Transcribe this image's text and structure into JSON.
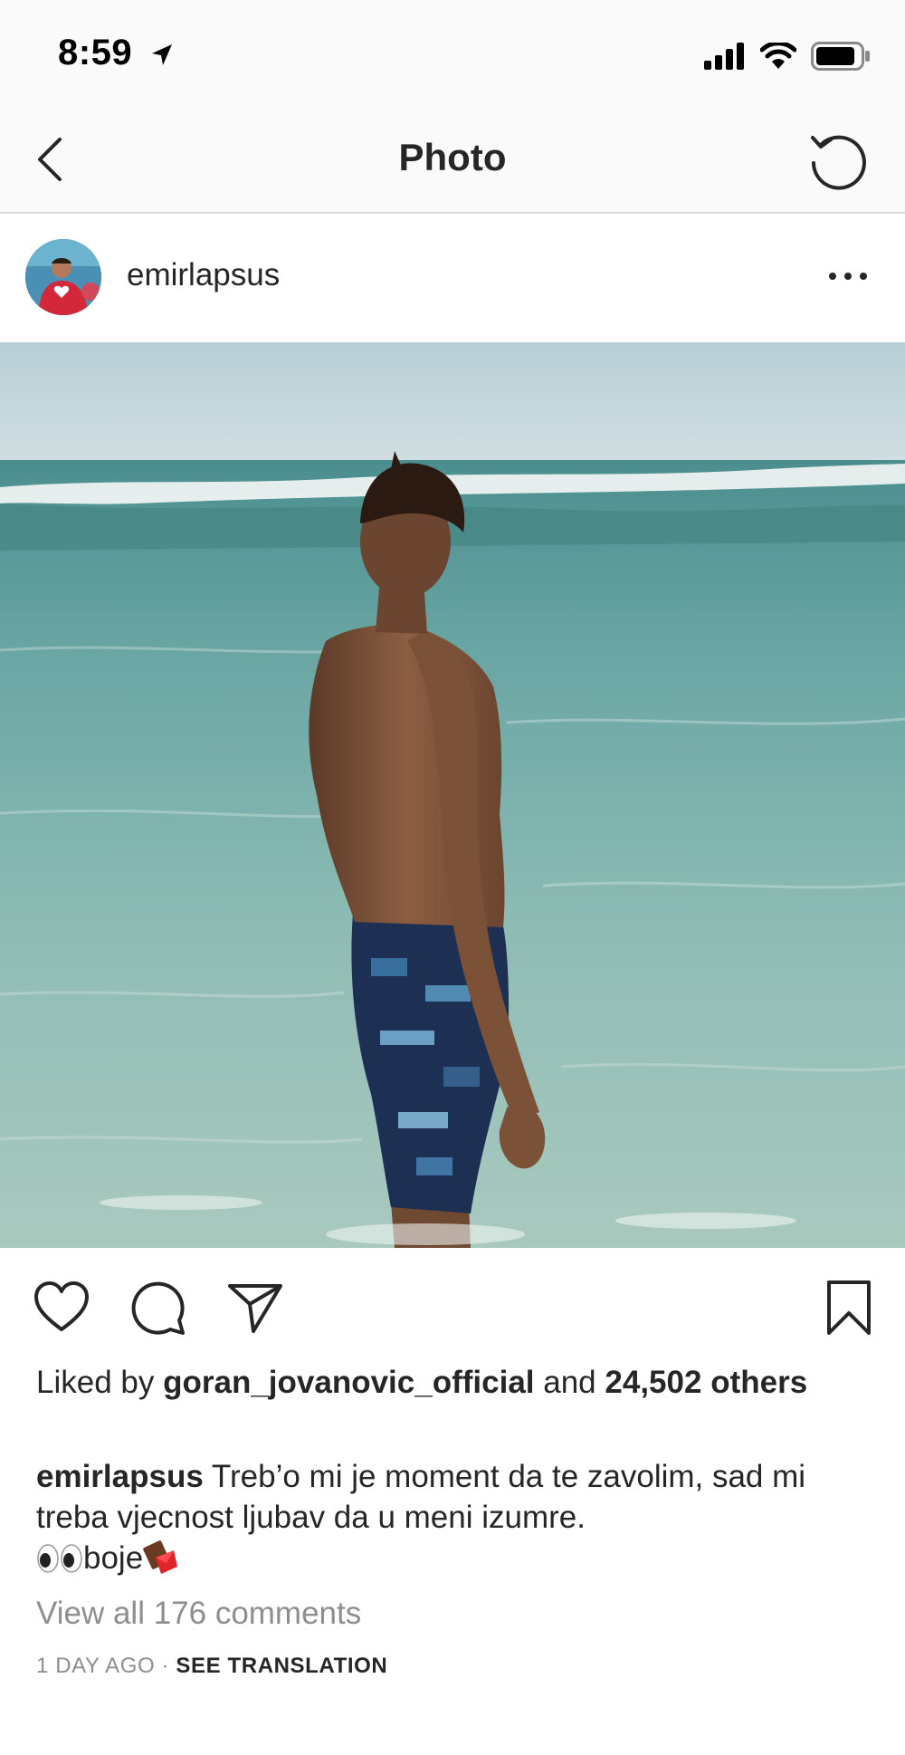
{
  "status_bar": {
    "time": "8:59"
  },
  "nav": {
    "title": "Photo"
  },
  "post": {
    "username": "emirlapsus",
    "likes": {
      "prefix": "Liked by",
      "liker": "goran_jovanovic_official",
      "joiner": "and",
      "count": "24,502",
      "suffix": "others"
    },
    "caption": {
      "username": "emirlapsus",
      "text": "Treb’o mi je moment da te zavolim, sad mi treba vjecnost ljubav da u meni izumre.",
      "line3_word": "boje"
    },
    "comments_link": "View all 176 comments",
    "timestamp": "1 DAY AGO",
    "separator": "·",
    "translate": "SEE TRANSLATION"
  },
  "icons": {
    "back": "chevron-left-icon",
    "refresh": "refresh-icon",
    "more": "more-dots-icon",
    "like": "heart-icon",
    "comment": "comment-icon",
    "share": "share-icon",
    "save": "bookmark-icon"
  },
  "colors": {
    "bar_bg": "#fafafa",
    "text": "#262626",
    "muted": "#8e8e8e",
    "divider": "#dbdbdb"
  }
}
